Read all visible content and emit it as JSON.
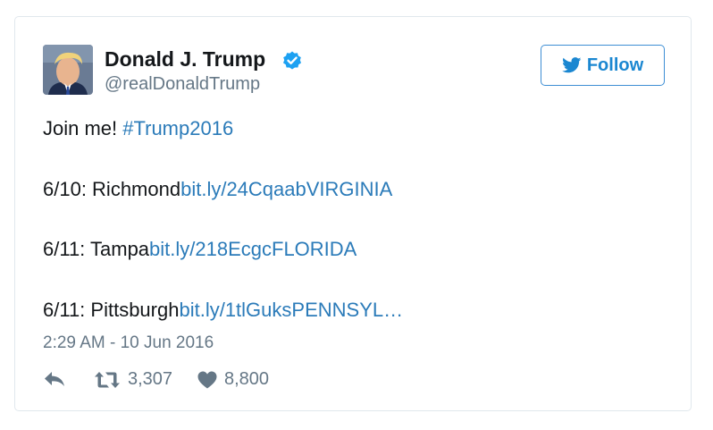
{
  "author": {
    "name": "Donald J. Trump",
    "handle": "@realDonaldTrump",
    "verified": true,
    "avatar_icon": "profile-photo"
  },
  "follow_button": {
    "label": "Follow",
    "icon": "twitter-bird-icon"
  },
  "tweet": {
    "line1": {
      "text": "Join me! ",
      "hashtag": "#Trump2016"
    },
    "line2": {
      "text": "6/10: Richmond",
      "link": "bit.ly/24CqaabVIRGINIA"
    },
    "line3": {
      "text": "6/11: Tampa",
      "link": "bit.ly/218EcgcFLORIDA"
    },
    "line4": {
      "text": "6/11: Pittsburgh",
      "link": "bit.ly/1tlGuksPENNSYL…"
    }
  },
  "timestamp": "2:29 AM - 10 Jun 2016",
  "actions": {
    "reply_icon": "reply-icon",
    "retweet_icon": "retweet-icon",
    "retweet_count": "3,307",
    "like_icon": "heart-icon",
    "like_count": "8,800"
  },
  "colors": {
    "accent": "#1da1f2",
    "link": "#2b7bb9",
    "muted": "#657786",
    "text": "#14171a",
    "border": "#e1e8ed"
  }
}
